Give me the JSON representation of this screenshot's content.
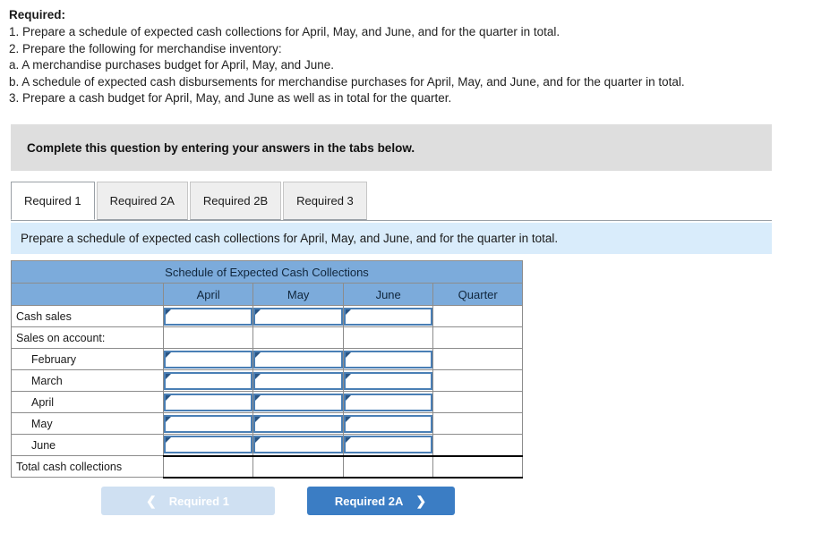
{
  "required": {
    "heading": "Required:",
    "lines": [
      "1. Prepare a schedule of expected cash collections for April, May, and June, and for the quarter in total.",
      "2. Prepare the following for merchandise inventory:",
      "a. A merchandise purchases budget for April, May, and June.",
      "b. A schedule of expected cash disbursements for merchandise purchases for April, May, and June, and for the quarter in total.",
      "3. Prepare a cash budget for April, May, and June as well as in total for the quarter."
    ]
  },
  "notice": {
    "text": "Complete this question by entering your answers in the tabs below."
  },
  "tabs": [
    {
      "label": "Required 1",
      "active": true
    },
    {
      "label": "Required 2A",
      "active": false
    },
    {
      "label": "Required 2B",
      "active": false
    },
    {
      "label": "Required 3",
      "active": false
    }
  ],
  "instruction": {
    "text": "Prepare a schedule of expected cash collections for April, May, and June, and for the quarter in total."
  },
  "table": {
    "title": "Schedule of Expected Cash Collections",
    "columns": [
      "",
      "April",
      "May",
      "June",
      "Quarter"
    ],
    "rows": [
      {
        "label": "Cash sales",
        "indent": false,
        "inputs": [
          true,
          true,
          true
        ],
        "quarter_input": false,
        "total": false
      },
      {
        "label": "Sales on account:",
        "indent": false,
        "inputs": [
          false,
          false,
          false
        ],
        "quarter_input": false,
        "total": false
      },
      {
        "label": "February",
        "indent": true,
        "inputs": [
          true,
          true,
          true
        ],
        "quarter_input": false,
        "total": false
      },
      {
        "label": "March",
        "indent": true,
        "inputs": [
          true,
          true,
          true
        ],
        "quarter_input": false,
        "total": false
      },
      {
        "label": "April",
        "indent": true,
        "inputs": [
          true,
          true,
          true
        ],
        "quarter_input": false,
        "total": false
      },
      {
        "label": "May",
        "indent": true,
        "inputs": [
          true,
          true,
          true
        ],
        "quarter_input": false,
        "total": false
      },
      {
        "label": "June",
        "indent": true,
        "inputs": [
          true,
          true,
          true
        ],
        "quarter_input": false,
        "total": false
      },
      {
        "label": "Total cash collections",
        "indent": false,
        "inputs": [
          false,
          false,
          false
        ],
        "quarter_input": false,
        "total": true
      }
    ]
  },
  "nav": {
    "prev_label": "Required 1",
    "prev_icon": "chevron-left-icon",
    "prev_disabled": true,
    "next_label": "Required 2A",
    "next_icon": "chevron-right-icon"
  },
  "colors": {
    "table_header_blue": "#7cabdb",
    "instruction_bar_blue": "#d9ecfb",
    "notice_gray": "#dedede",
    "input_border_blue": "#4a7fb5",
    "input_marker_blue": "#2a5584",
    "button_active_blue": "#3b7dc4",
    "button_disabled_blue": "#cfe0f2"
  }
}
